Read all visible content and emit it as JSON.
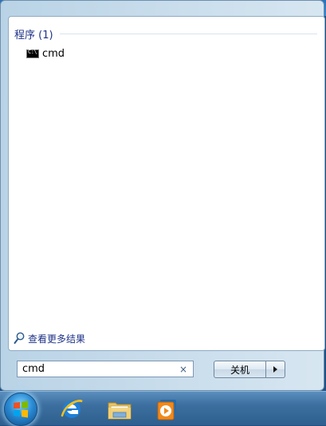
{
  "search_results": {
    "group_title": "程序 (1)",
    "items": [
      {
        "label": "cmd",
        "icon": "cmd-icon"
      }
    ],
    "see_more_label": "查看更多结果"
  },
  "search": {
    "value": "cmd",
    "clear_glyph": "×"
  },
  "shutdown": {
    "label": "关机"
  },
  "taskbar": {
    "items": [
      "start-orb",
      "internet-explorer-icon",
      "windows-explorer-icon",
      "media-player-icon"
    ]
  }
}
